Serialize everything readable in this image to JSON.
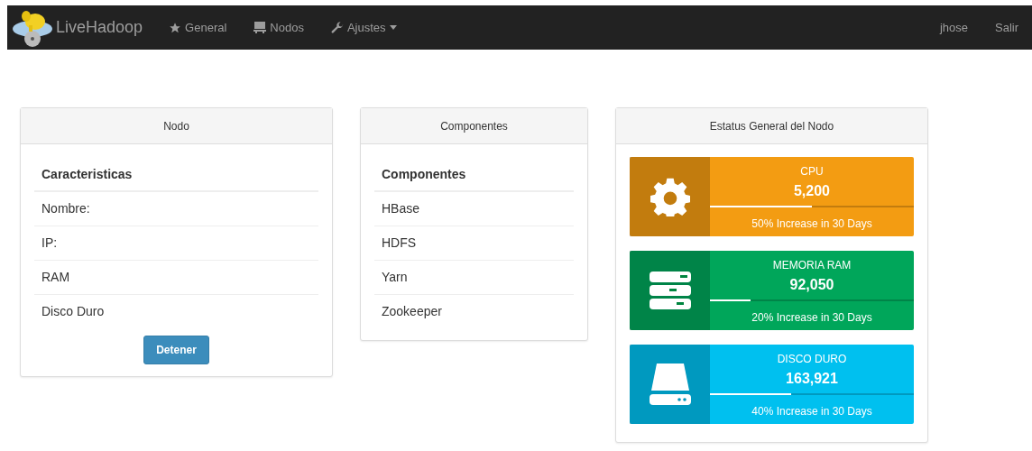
{
  "navbar": {
    "brand": "LiveHadoop",
    "items": [
      {
        "label": "General",
        "kind": "star",
        "caret": false
      },
      {
        "label": "Nodos",
        "kind": "monitor",
        "caret": false
      },
      {
        "label": "Ajustes",
        "kind": "wrench",
        "caret": true
      }
    ],
    "user": "jhose",
    "logout": "Salir"
  },
  "node_panel": {
    "title": "Nodo",
    "heading": "Caracteristicas",
    "rows": [
      "Nombre:",
      "IP:",
      "RAM",
      "Disco Duro"
    ],
    "button": "Detener"
  },
  "components_panel": {
    "title": "Componentes",
    "heading": "Componentes",
    "rows": [
      "HBase",
      "HDFS",
      "Yarn",
      "Zookeeper"
    ]
  },
  "status_panel": {
    "title": "Estatus General del Nodo",
    "stats": [
      {
        "kind": "gear",
        "label": "CPU",
        "value": "5,200",
        "level": 0.5,
        "note": "50% Increase in 30 Days",
        "color": "#f39c12"
      },
      {
        "kind": "server",
        "label": "MEMORIA RAM",
        "value": "92,050",
        "level": 0.2,
        "note": "20% Increase in 30 Days",
        "color": "#00a65a"
      },
      {
        "kind": "drive",
        "label": "DISCO DURO",
        "value": "163,921",
        "level": 0.4,
        "note": "40% Increase in 30 Days",
        "color": "#00c0ef"
      }
    ]
  }
}
